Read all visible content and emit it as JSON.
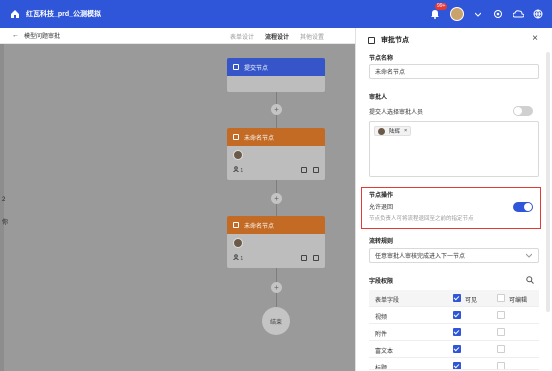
{
  "topbar": {
    "title": "红瓦科技_prd_公测模拟",
    "notification_badge": "99+",
    "bg_color": "#2f56d8"
  },
  "subbar": {
    "back_label": "←",
    "breadcrumb": "模型问题审批",
    "tabs": [
      "表单设计",
      "流程设计",
      "其他设置"
    ],
    "active_tab": "流程设计"
  },
  "canvas": {
    "side_chars": [
      "2",
      "你"
    ],
    "start_node": {
      "label": "提交节点"
    },
    "approve_nodes": [
      {
        "label": "未命名节点",
        "count": "1"
      },
      {
        "label": "未命名节点",
        "count": "1"
      }
    ],
    "plus_symbol": "+",
    "end_label": "结束"
  },
  "panel": {
    "title": "审批节点",
    "close": "×",
    "node_name_label": "节点名称",
    "node_name_value": "未命名节点",
    "approver_label": "审批人",
    "self_select_label": "提交人选择审批人员",
    "self_select_on": false,
    "approver_chip": "陆辉",
    "chip_close": "×",
    "node_ops_label": "节点操作",
    "allow_return_label": "允许退回",
    "allow_return_hint": "节点负责人可将流程退回至之前的指定节点",
    "allow_return_on": true,
    "flow_rule_label": "流转规则",
    "flow_rule_value": "任意审批人审核完成进入下一节点",
    "field_perm_label": "字段权限",
    "table": {
      "headers": [
        "表单字段",
        "可见",
        "可编辑"
      ],
      "rows": [
        {
          "name": "视频",
          "visible": true,
          "editable": false
        },
        {
          "name": "附件",
          "visible": true,
          "editable": false
        },
        {
          "name": "富文本",
          "visible": true,
          "editable": false
        },
        {
          "name": "标题",
          "visible": true,
          "editable": false
        }
      ]
    }
  }
}
